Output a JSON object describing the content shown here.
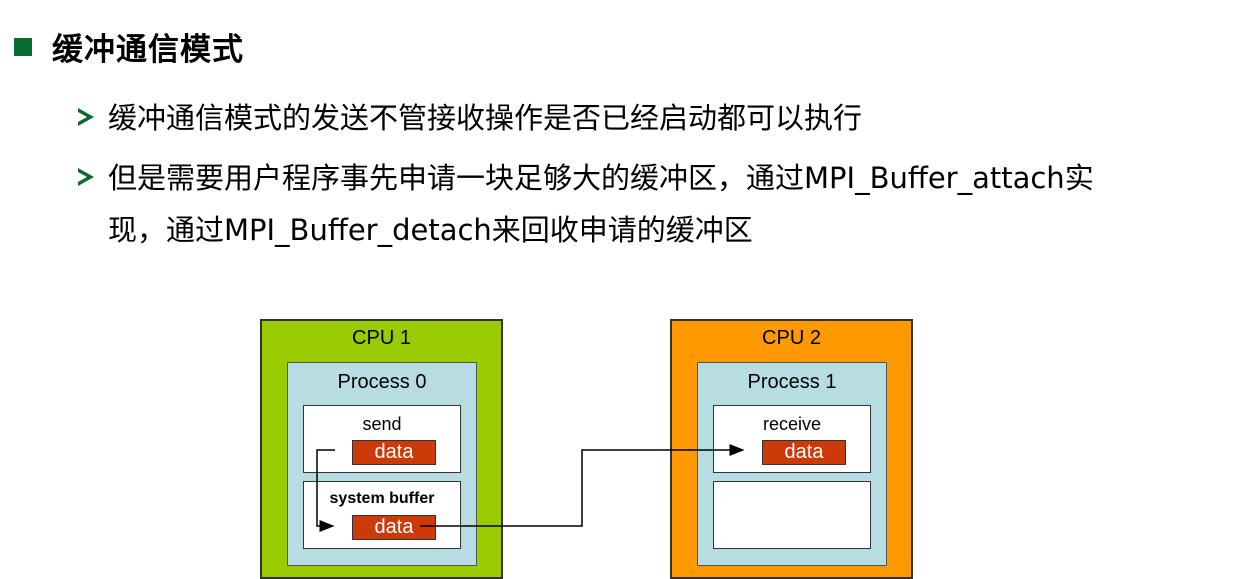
{
  "heading": "缓冲通信模式",
  "bullets": [
    "缓冲通信模式的发送不管接收操作是否已经启动都可以执行",
    "但是需要用户程序事先申请一块足够大的缓冲区，通过MPI_Buffer_attach实",
    "现，通过MPI_Buffer_detach来回收申请的缓冲区"
  ],
  "diagram": {
    "cpu1": {
      "label": "CPU 1",
      "color": "#99cc00",
      "process": "Process 0",
      "send": "send",
      "send_data": "data",
      "system_buffer": "system buffer",
      "buffer_data": "data"
    },
    "cpu2": {
      "label": "CPU 2",
      "color": "#ff9900",
      "process": "Process 1",
      "receive": "receive",
      "receive_data": "data"
    }
  },
  "colors": {
    "accent_green": "#0a6b2f",
    "process_bg": "#b7dde3",
    "data_red": "#cc3a0a"
  }
}
